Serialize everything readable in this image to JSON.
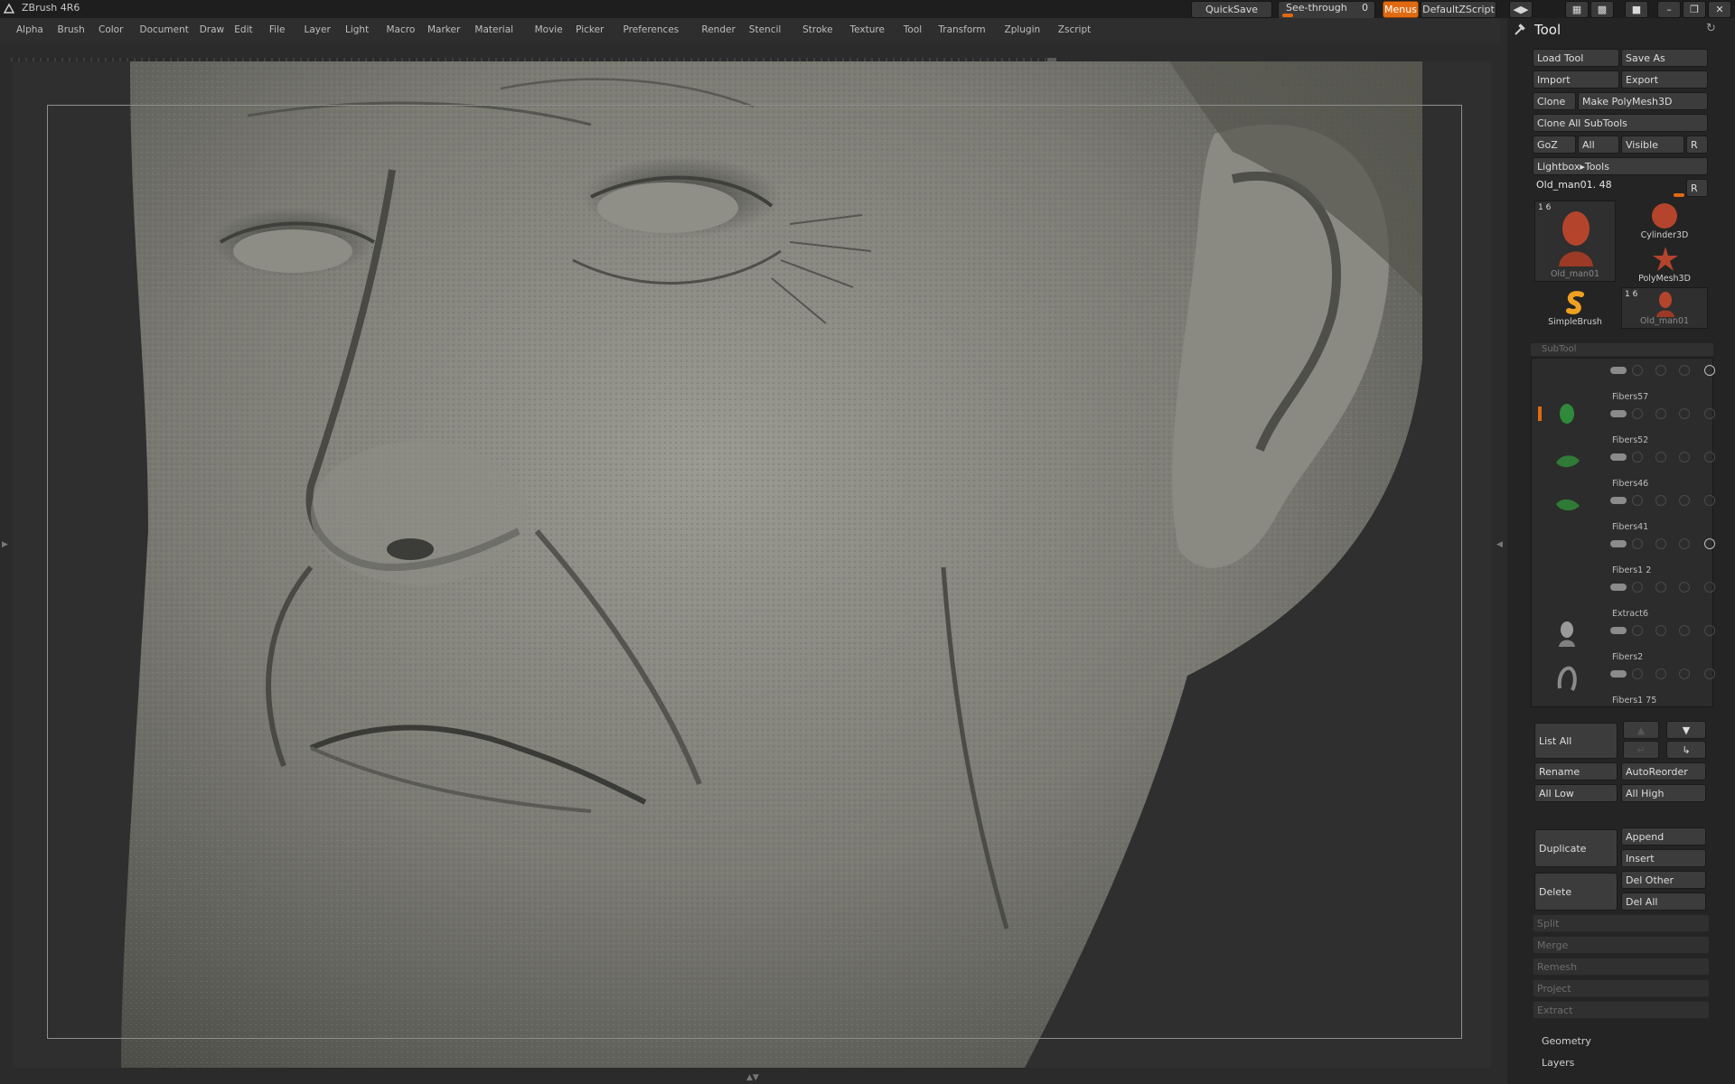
{
  "app": {
    "title": "ZBrush 4R6"
  },
  "topbar": {
    "quicksave": "QuickSave",
    "see_through_label": "See-through",
    "see_through_value": "0",
    "menus": "Menus",
    "default_zscript": "DefaultZScript"
  },
  "menubar": {
    "items": [
      "Alpha",
      "Brush",
      "Color",
      "Document",
      "Draw",
      "Edit",
      "File",
      "Layer",
      "Light",
      "Macro",
      "Marker",
      "Material",
      "Movie",
      "Picker",
      "Preferences",
      "Render",
      "Stencil",
      "Stroke",
      "Texture",
      "Tool",
      "Transform",
      "Zplugin",
      "Zscript"
    ]
  },
  "tool_panel": {
    "title": "Tool",
    "load_tool": "Load Tool",
    "save_as": "Save As",
    "import": "Import",
    "export": "Export",
    "clone": "Clone",
    "make_polymesh": "Make PolyMesh3D",
    "clone_all": "Clone All SubTools",
    "goz": "GoZ",
    "all": "All",
    "visible": "Visible",
    "r": "R",
    "lightbox_tools": "Lightbox▸Tools",
    "current_tool": "Old_man01. 48",
    "current_r": "R",
    "thumbnails": [
      {
        "label": "Old_man01",
        "count": "1 6",
        "icon": "head-sculpt-icon"
      },
      {
        "label": "Cylinder3D",
        "icon": "cylinder-icon"
      },
      {
        "label": "PolyMesh3D",
        "icon": "star-icon"
      },
      {
        "label": "SimpleBrush",
        "icon": "simple-brush-icon"
      },
      {
        "label": "Old_man01",
        "count": "1 6",
        "icon": "head-sculpt-icon"
      }
    ]
  },
  "subtool": {
    "header": "SubTool",
    "items": [
      "Fibers57",
      "Fibers52",
      "Fibers46",
      "Fibers41",
      "Fibers1 2",
      "Extract6",
      "Fibers2",
      "Fibers1 75"
    ],
    "list_all": "List All",
    "rename": "Rename",
    "autoreorder": "AutoReorder",
    "all_low": "All Low",
    "all_high": "All High",
    "duplicate": "Duplicate",
    "append": "Append",
    "insert": "Insert",
    "delete": "Delete",
    "del_other": "Del Other",
    "del_all": "Del All",
    "split": "Split",
    "merge": "Merge",
    "remesh": "Remesh",
    "project": "Project",
    "extract": "Extract"
  },
  "sections": {
    "geometry": "Geometry",
    "layers": "Layers"
  }
}
